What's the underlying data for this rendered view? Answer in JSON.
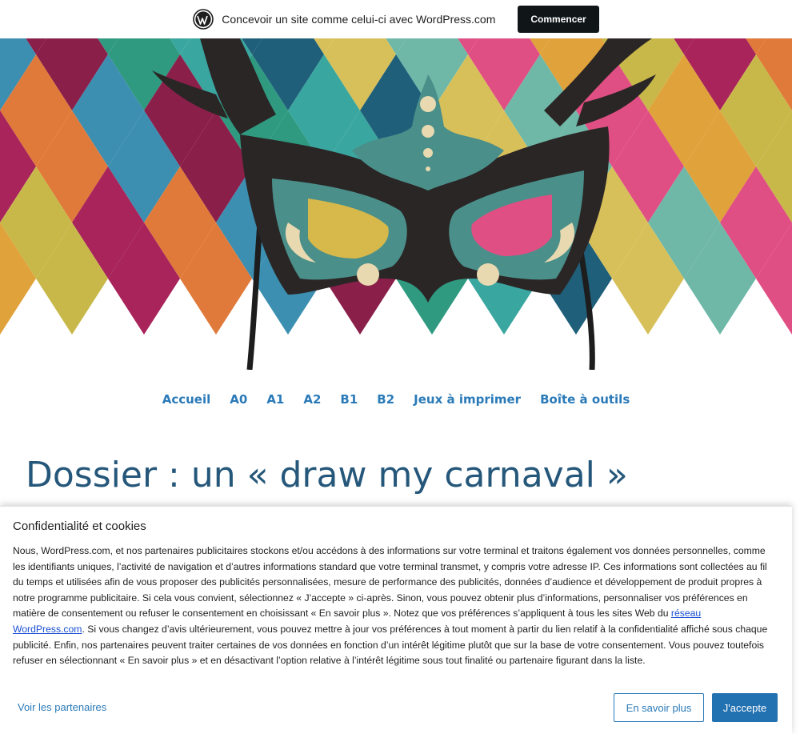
{
  "banner": {
    "text": "Concevoir un site comme celui-ci avec WordPress.com",
    "button_label": "Commencer"
  },
  "nav": {
    "items": [
      {
        "label": "Accueil"
      },
      {
        "label": "A0"
      },
      {
        "label": "A1"
      },
      {
        "label": "A2"
      },
      {
        "label": "B1"
      },
      {
        "label": "B2"
      },
      {
        "label": "Jeux à imprimer"
      },
      {
        "label": "Boîte à outils"
      }
    ]
  },
  "post": {
    "title": "Dossier : un « draw my carnaval »"
  },
  "cookie": {
    "title": "Confidentialité et cookies",
    "body_part1": "Nous, WordPress.com, et nos partenaires publicitaires stockons et/ou accédons à des informations sur votre terminal et traitons également vos données personnelles, comme les identifiants uniques, l’activité de navigation et d’autres informations standard que votre terminal transmet, y compris votre adresse IP. Ces informations sont collectées au fil du temps et utilisées afin de vous proposer des publicités personnalisées, mesure de performance des publicités, données d’audience et développement de produit propres à notre programme publicitaire. Si cela vous convient, sélectionnez « J’accepte » ci-après. Sinon, vous pouvez obtenir plus d’informations, personnaliser vos préférences en matière de consentement ou refuser le consentement en choisissant « En savoir plus ». Notez que vos préférences s’appliquent à tous les sites Web du ",
    "link_text": "réseau WordPress.com",
    "body_part2": ". Si vous changez d’avis ultérieurement, vous pouvez mettre à jour vos préférences à tout moment à partir du lien relatif à la confidentialité affiché sous chaque publicité. Enfin, nos partenaires peuvent traiter certaines de vos données en fonction d’un intérêt légitime plutôt que sur la base de votre consentement. Vous pouvez toutefois refuser en sélectionnant « En savoir plus » et en désactivant l’option relative à l’intérêt légitime sous tout finalité ou partenaire figurant dans la liste.",
    "partners_label": "Voir les partenaires",
    "more_label": "En savoir plus",
    "accept_label": "J'accepte"
  },
  "colors": {
    "nav_link": "#2a7ab8",
    "title": "#25577a",
    "accept_button": "#2271b1",
    "banner_button": "#101517"
  }
}
